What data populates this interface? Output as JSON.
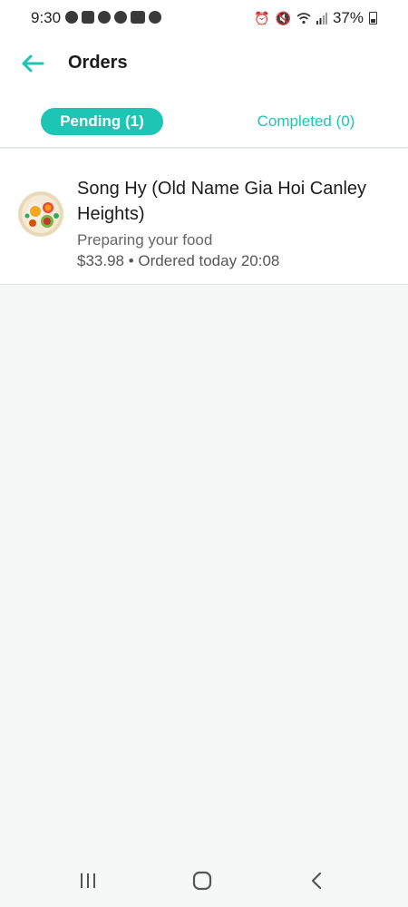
{
  "status_bar": {
    "time": "9:30",
    "battery": "37%",
    "left_icons": [
      "messenger-icon",
      "notification-icon",
      "shazam-icon",
      "refresh-icon",
      "app-icon",
      "accessibility-icon"
    ],
    "right_icons": [
      "alarm-icon",
      "mute-icon",
      "wifi-icon",
      "signal-icon",
      "battery-icon"
    ]
  },
  "header": {
    "title": "Orders",
    "tabs": {
      "pending": "Pending (1)",
      "completed": "Completed (0)"
    }
  },
  "orders": [
    {
      "restaurant": "Song Hy (Old Name Gia Hoi Canley Heights)",
      "status": "Preparing your food",
      "price": "$33.98",
      "separator": "•",
      "ordered": "Ordered today 20:08"
    }
  ],
  "colors": {
    "accent": "#1cc5b4",
    "background": "#f6f8f8",
    "card": "#ffffff"
  },
  "nav": [
    "recent-apps-icon",
    "home-icon",
    "back-icon"
  ]
}
